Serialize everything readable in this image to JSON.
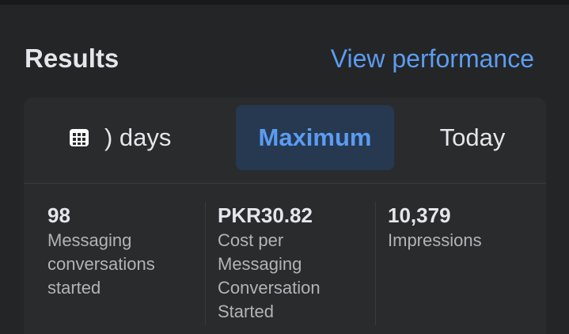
{
  "header": {
    "title": "Results",
    "view_link": "View performance"
  },
  "tabs": [
    {
      "label": ") days",
      "icon": "calendar-icon"
    },
    {
      "label": "Maximum",
      "selected": true
    },
    {
      "label": "Today"
    }
  ],
  "metrics": [
    {
      "value": "98",
      "label": "Messaging conversations started"
    },
    {
      "value": "PKR30.82",
      "label": "Cost per Messaging Conversation Started"
    },
    {
      "value": "10,379",
      "label": "Impressions"
    }
  ],
  "colors": {
    "background": "#242526",
    "card": "#2a2b2c",
    "accent": "#5b9cf2",
    "selected_tab_bg": "#263951",
    "primary_text": "#e4e6eb",
    "secondary_text": "#b0b3b8"
  }
}
